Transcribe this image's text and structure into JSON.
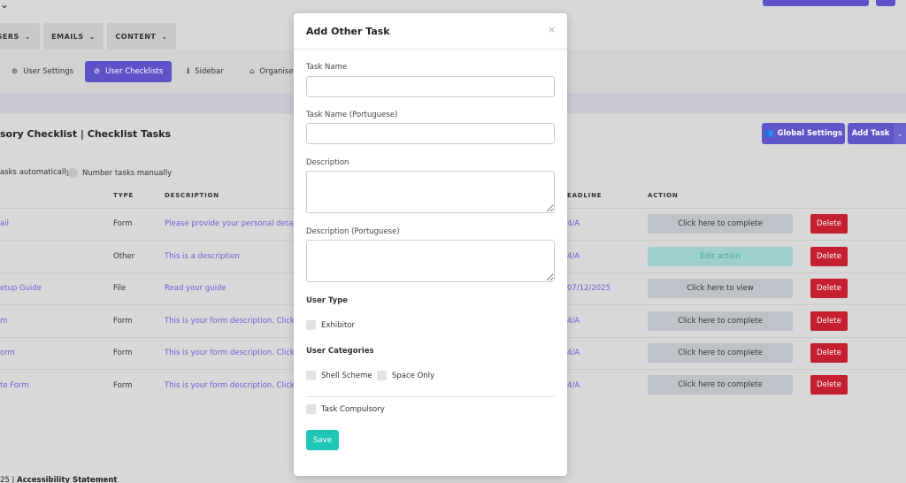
{
  "colors": {
    "primary": "#5e52c9",
    "danger": "#c52031",
    "success": "#1fc5b7",
    "link": "#6a5fd1"
  },
  "tabs": [
    {
      "label": "SERS",
      "icon": "chevron-down-icon"
    },
    {
      "label": "EMAILS",
      "icon": "chevron-down-icon"
    },
    {
      "label": "CONTENT",
      "icon": "chevron-down-icon"
    }
  ],
  "subnav": [
    {
      "label": "User Settings",
      "icon": "dashboard-icon"
    },
    {
      "label": "User Checklists",
      "icon": "check-circle-icon",
      "active": true
    },
    {
      "label": "Sidebar",
      "icon": "info-icon"
    },
    {
      "label": "Organise",
      "icon": "bank-icon"
    }
  ],
  "panel": {
    "title": "sory Checklist | Checklist Tasks",
    "global_settings": "Global Settings",
    "add_task": "Add Task",
    "radio_auto": "asks automatically",
    "radio_manual": "Number tasks manually"
  },
  "table": {
    "headers": [
      "TYPE",
      "DESCRIPTION",
      "EADLINE",
      "ACTION"
    ],
    "rows": [
      {
        "name": "ail",
        "type": "Form",
        "desc": "Please provide your personal detail",
        "deadline": "4/A",
        "action": "Click here to complete",
        "delete": "Delete"
      },
      {
        "name": "",
        "type": "Other",
        "desc": "This is a description",
        "deadline": "4/A",
        "action": "Edit action",
        "delete": "Delete"
      },
      {
        "name": "etup Guide",
        "type": "File",
        "desc": "Read your guide",
        "deadline": "07/12/2025",
        "action": "Click here to view",
        "delete": "Delete"
      },
      {
        "name": "m",
        "type": "Form",
        "desc": "This is your form description. Click he",
        "deadline": "4/A",
        "action": "Click here to complete",
        "delete": "Delete"
      },
      {
        "name": "orm",
        "type": "Form",
        "desc": "This is your form description. Click he",
        "deadline": "4/A",
        "action": "Click here to complete",
        "delete": "Delete"
      },
      {
        "name": "te Form",
        "type": "Form",
        "desc": "This is your form description. Click he",
        "deadline": "4/A",
        "action": "Click here to complete",
        "delete": "Delete"
      }
    ]
  },
  "footer": {
    "year": "25",
    "sep": "|",
    "link": "Accessibility Statement"
  },
  "modal": {
    "title": "Add Other Task",
    "close": "×",
    "task_name_label": "Task Name",
    "task_name_value": "",
    "task_name_pt_label": "Task Name (Portuguese)",
    "task_name_pt_value": "",
    "description_label": "Description",
    "description_value": "",
    "description_pt_label": "Description (Portuguese)",
    "description_pt_value": "",
    "user_type_heading": "User Type",
    "user_types": [
      "Exhibitor"
    ],
    "user_categories_heading": "User Categories",
    "user_categories": [
      "Shell Scheme",
      "Space Only"
    ],
    "task_compulsory": "Task Compulsory",
    "save": "Save"
  }
}
